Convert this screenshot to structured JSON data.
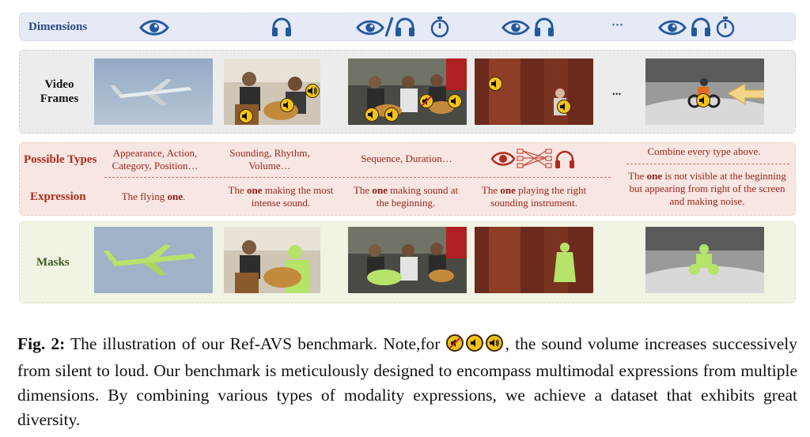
{
  "rows": {
    "dimensions": "Dimensions",
    "video_frames": "Video Frames",
    "possible_types": "Possible Types",
    "expression": "Expression",
    "masks": "Masks"
  },
  "dimension_icons": [
    [
      "eye-icon"
    ],
    [
      "headphones-icon"
    ],
    [
      "eye-icon",
      "slash",
      "headphones-icon",
      "stopwatch-icon"
    ],
    [
      "eye-icon",
      "headphones-icon"
    ],
    [
      "ellipsis"
    ],
    [
      "eye-icon",
      "headphones-icon",
      "stopwatch-icon"
    ]
  ],
  "ellipsis": "...",
  "ellipsis_small": "···",
  "possible_types": [
    "Appearance, Action, Category, Position…",
    "Sounding, Rhythm, Volume…",
    "Sequence, Duration…",
    "",
    "Combine every type above."
  ],
  "expressions": [
    {
      "pre": "The flying ",
      "bold": "one",
      "post": "."
    },
    {
      "pre": "The ",
      "bold": "one",
      "post": " making the most intense sound."
    },
    {
      "pre": "The ",
      "bold": "one",
      "post": " making sound at the beginning."
    },
    {
      "pre": "The ",
      "bold": "one",
      "post": " playing the right sounding instrument."
    },
    {
      "pre": "The ",
      "bold": "one",
      "post": " is not visible at the beginning but appearing from right of the screen and making noise."
    }
  ],
  "caption": {
    "label": "Fig. 2:",
    "text_before_icons": " The illustration of our Ref-AVS benchmark. Note,for ",
    "text_after_icons": ", the sound volume increases successively from silent to loud. Our benchmark is meticulously designed to encompass multimodal expressions from multiple dimensions. By combining various types of modality expressions, we achieve a dataset that exhibits great diversity."
  },
  "colors": {
    "dimension_band": "#e6e9f6",
    "frames_band": "#ececec",
    "types_band": "#f8e6e2",
    "masks_band": "#f1f3e3",
    "icon_blue": "#22599e",
    "label_red": "#b12a1e",
    "mask_green": "#b6e36a",
    "volume_badge": "#f5c21a"
  }
}
